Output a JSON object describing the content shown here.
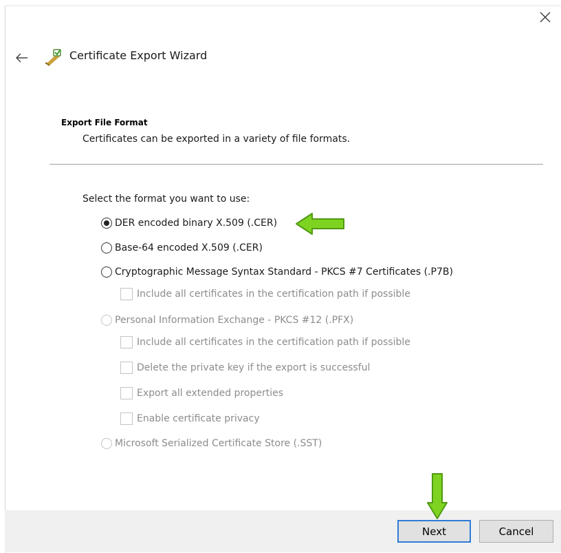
{
  "wizard": {
    "title": "Certificate Export Wizard",
    "icons": {
      "close": "close-icon",
      "back": "back-arrow-icon",
      "title": "certificate-icon"
    }
  },
  "section": {
    "heading": "Export File Format",
    "description": "Certificates can be exported in a variety of file formats."
  },
  "format": {
    "prompt": "Select the format you want to use:",
    "options": [
      {
        "label": "DER encoded binary X.509 (.CER)",
        "checked": true,
        "enabled": true
      },
      {
        "label": "Base-64 encoded X.509 (.CER)",
        "checked": false,
        "enabled": true
      },
      {
        "label": "Cryptographic Message Syntax Standard - PKCS #7 Certificates (.P7B)",
        "checked": false,
        "enabled": true
      },
      {
        "label": "Personal Information Exchange - PKCS #12 (.PFX)",
        "checked": false,
        "enabled": false
      },
      {
        "label": "Microsoft Serialized Certificate Store (.SST)",
        "checked": false,
        "enabled": false
      }
    ],
    "p7b_checkbox": "Include all certificates in the certification path if possible",
    "pfx_checkboxes": [
      "Include all certificates in the certification path if possible",
      "Delete the private key if the export is successful",
      "Export all extended properties",
      "Enable certificate privacy"
    ]
  },
  "footer": {
    "next_label": "Next",
    "cancel_label": "Cancel"
  },
  "colors": {
    "annotation_arrow": "#7ed321",
    "next_focus_border": "#2f7bd6"
  }
}
